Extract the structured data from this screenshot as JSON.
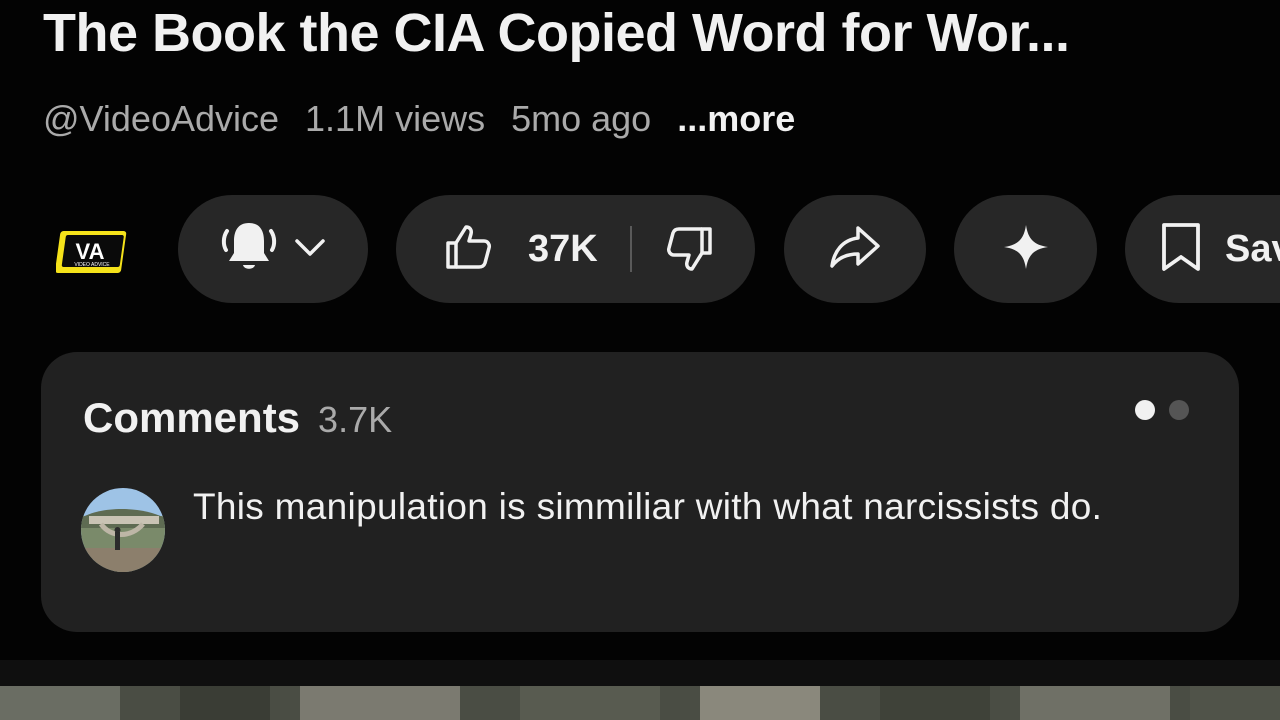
{
  "video": {
    "title": "The Book the CIA Copied Word for Wor...",
    "channel_handle": "@VideoAdvice",
    "views": "1.1M views",
    "age": "5mo ago",
    "more_label": "...more"
  },
  "channel_logo": {
    "text": "VA",
    "subtext": "VIDEO ADVICE",
    "color": "#f5e21a"
  },
  "actions": {
    "like_count": "37K",
    "save_label": "Sav"
  },
  "comments": {
    "title": "Comments",
    "count": "3.7K",
    "top_comment": {
      "text": "This manipulation is simmiliar with what narcissists do."
    }
  },
  "colors": {
    "background": "#030303",
    "pill": "#272727",
    "card": "#212121",
    "text_secondary": "#aaaaaa"
  }
}
